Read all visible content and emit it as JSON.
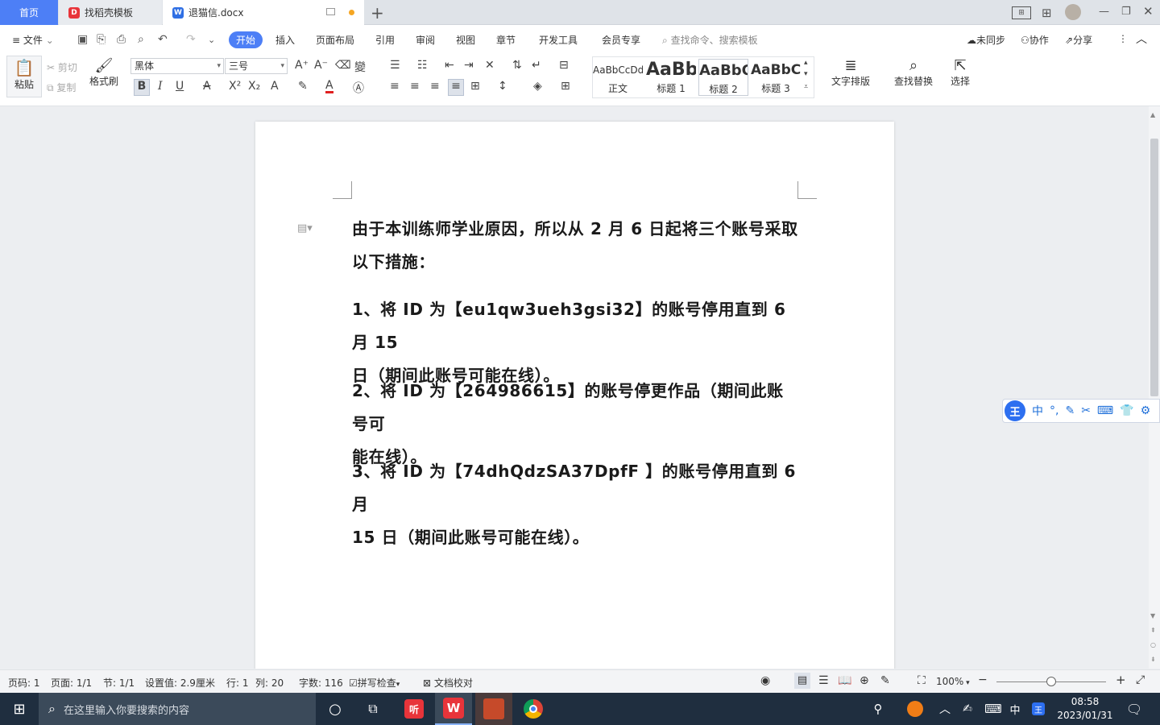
{
  "tabs": {
    "home": "首页",
    "templates": "找稻壳模板",
    "document": "退猫信.docx"
  },
  "menu": {
    "file": "文件",
    "items": [
      "开始",
      "插入",
      "页面布局",
      "引用",
      "审阅",
      "视图",
      "章节",
      "开发工具",
      "会员专享"
    ],
    "search_placeholder": "查找命令、搜索模板",
    "sync": "未同步",
    "collab": "协作",
    "share": "分享"
  },
  "ribbon": {
    "paste": "粘贴",
    "cut": "剪切",
    "copy": "复制",
    "format_painter": "格式刷",
    "font_name": "黑体",
    "font_size": "三号",
    "styles": [
      {
        "preview": "AaBbCcDd",
        "label": "正文"
      },
      {
        "preview": "AaBb",
        "label": "标题 1"
      },
      {
        "preview": "AaBbC",
        "label": "标题 2"
      },
      {
        "preview": "AaBbC",
        "label": "标题 3"
      }
    ],
    "text_layout": "文字排版",
    "find_replace": "查找替换",
    "select": "选择"
  },
  "document": {
    "paragraphs": [
      [
        "由于本训练师学业原因，所以从 2 月 6 日起将三个账号采取",
        "以下措施："
      ],
      [
        "1、将 ID 为【eu1qw3ueh3gsi32】的账号停用直到 6 月 15",
        "日（期间此账号可能在线）。"
      ],
      [
        "2、将 ID 为【264986615】的账号停更作品（期间此账号可",
        "能在线）。"
      ],
      [
        "3、将 ID 为【74dhQdzSA37DpfF 】的账号停用直到 6 月",
        "15 日（期间此账号可能在线）。"
      ]
    ]
  },
  "ime": {
    "mode": "中"
  },
  "status": {
    "page": "页码: 1",
    "pages": "页面: 1/1",
    "section": "节: 1/1",
    "setting": "设置值: 2.9厘米",
    "row": "行: 1",
    "col": "列: 20",
    "words": "字数: 116",
    "spell": "拼写检查",
    "proof": "文档校对",
    "zoom": "100%"
  },
  "taskbar": {
    "search_placeholder": "在这里输入你要搜索的内容",
    "ime": "中",
    "time": "08:58",
    "date": "2023/01/31"
  },
  "colors": {
    "accent": "#4d7ff6",
    "taskbar": "#1f2e3f"
  }
}
